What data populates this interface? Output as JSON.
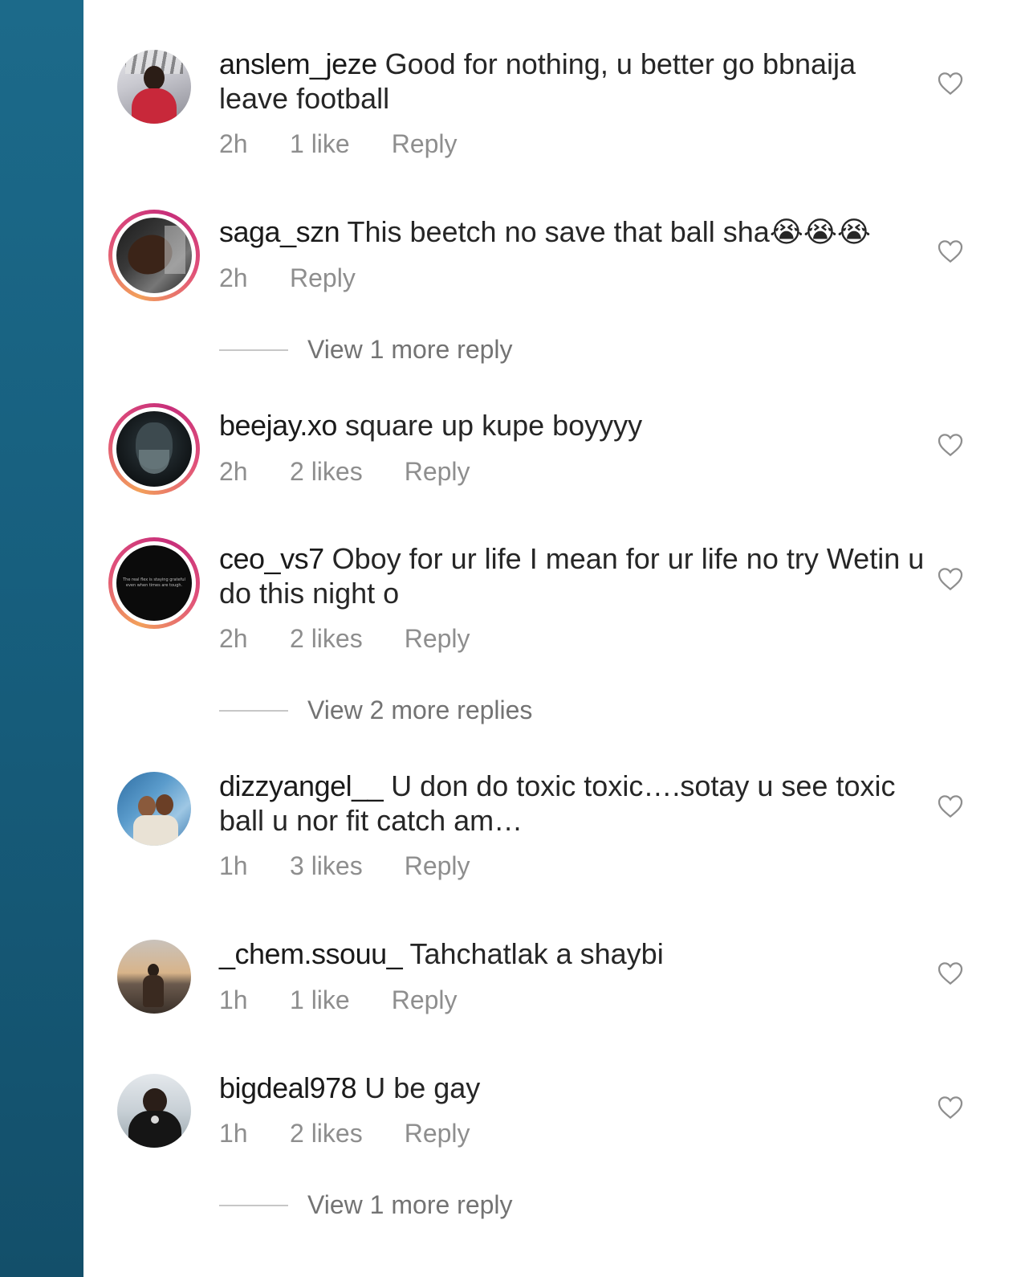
{
  "comments": [
    {
      "username": "anslem_jeze",
      "text": "Good for nothing, u better go bbnaija leave football",
      "time": "2h",
      "likes": "1 like",
      "reply": "Reply"
    },
    {
      "username": "saga_szn",
      "text": "This beetch no save that ball sha😭😭😭",
      "time": "2h",
      "likes": "",
      "reply": "Reply"
    },
    {
      "username": "beejay.xo",
      "text": "square up kupe boyyyy",
      "time": "2h",
      "likes": "2 likes",
      "reply": "Reply"
    },
    {
      "username": "ceo_vs7",
      "text": "Oboy for ur life I mean for ur life no try Wetin u do this night o",
      "time": "2h",
      "likes": "2 likes",
      "reply": "Reply"
    },
    {
      "username": "dizzyangel__",
      "text": "U don do toxic toxic….sotay u see toxic ball u nor fit catch am…",
      "time": "1h",
      "likes": "3 likes",
      "reply": "Reply"
    },
    {
      "username": "_chem.ssouu_",
      "text": "Tahchatlak a shaybi",
      "time": "1h",
      "likes": "1 like",
      "reply": "Reply"
    },
    {
      "username": "bigdeal978",
      "text": "U be gay",
      "time": "1h",
      "likes": "2 likes",
      "reply": "Reply"
    }
  ],
  "view_more": {
    "saga": "View 1 more reply",
    "ceo": "View 2 more replies",
    "bigdeal": "View 1 more reply"
  },
  "avatar_caption": "The real flex is staying grateful even when times are tough.",
  "icons": {
    "like": "heart-outline-icon"
  },
  "colors": {
    "side_strip": "#175f7e",
    "meta_text": "#8e8e8e",
    "story_ring": "#e0507a"
  }
}
